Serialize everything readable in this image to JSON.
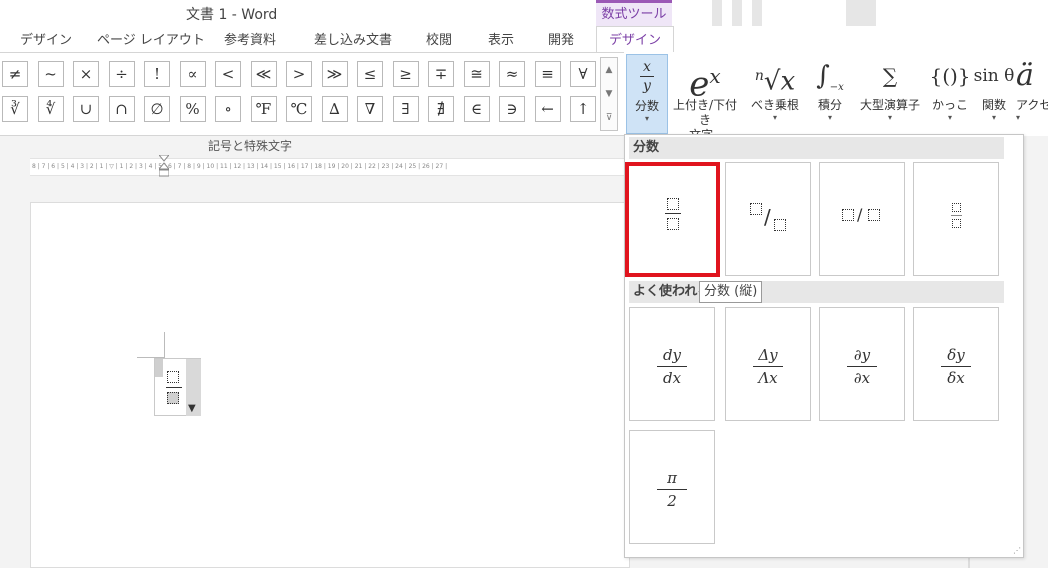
{
  "window": {
    "title": "文書 1 - Word",
    "context_tab_group": "数式ツール"
  },
  "tabs": [
    {
      "label": "デザイン"
    },
    {
      "label": "ページ レイアウト"
    },
    {
      "label": "参考資料"
    },
    {
      "label": "差し込み文書"
    },
    {
      "label": "校閲"
    },
    {
      "label": "表示"
    },
    {
      "label": "開発"
    },
    {
      "label": "デザイン",
      "active": true
    }
  ],
  "symbols": {
    "row1": [
      "≠",
      "~",
      "×",
      "÷",
      "!",
      "∝",
      "<",
      "≪",
      ">",
      "≫",
      "≤",
      "≥",
      "∓",
      "≅",
      "≈",
      "≡",
      "∀"
    ],
    "row2": [
      "∛",
      "∜",
      "∪",
      "∩",
      "∅",
      "%",
      "∘",
      "℉",
      "℃",
      "∆",
      "∇",
      "∃",
      "∄",
      "∈",
      "∋",
      "←",
      "↑"
    ],
    "group_label": "記号と特殊文字"
  },
  "structures": [
    {
      "label": "分数",
      "label2": "",
      "glyph": "x/y"
    },
    {
      "label": "上付き/下付き",
      "label2": "文字",
      "glyph": "eˣ"
    },
    {
      "label": "べき乗根",
      "label2": "",
      "glyph": "ⁿ√x"
    },
    {
      "label": "積分",
      "label2": "",
      "glyph": "∫"
    },
    {
      "label": "大型演算子",
      "label2": "",
      "glyph": "∑"
    },
    {
      "label": "かっこ",
      "label2": "",
      "glyph": "{()}"
    },
    {
      "label": "関数",
      "label2": "",
      "glyph": "sin θ"
    },
    {
      "label": "アクセ",
      "label2": "",
      "glyph": "ä"
    }
  ],
  "ruler_text": "8 | 7 | 6 | 5 | 4 | 3 | 2 | 1 | ▽ | 1 | 2 | 3 | 4 | 5 | 6 | 7 | 8 | 9 | 10 | 11 | 12 | 13 | 14 | 15 | 16 | 17 | 18 | 19 | 20 | 21 | 22 | 23 | 24 | 25 | 26 | 27 |",
  "gallery": {
    "section1": "分数",
    "section2": "よく使われる分数",
    "tooltip": "分数 (縦)",
    "common": [
      {
        "num": "dy",
        "den": "dx"
      },
      {
        "num": "Δy",
        "den": "Λx"
      },
      {
        "num": "∂y",
        "den": "∂x"
      },
      {
        "num": "δy",
        "den": "δx"
      },
      {
        "num": "π",
        "den": "2"
      }
    ]
  },
  "colors": {
    "accent_purple": "#7b3fa6",
    "selection_red": "#e0141e",
    "selected_blue": "#cfe3f6"
  }
}
